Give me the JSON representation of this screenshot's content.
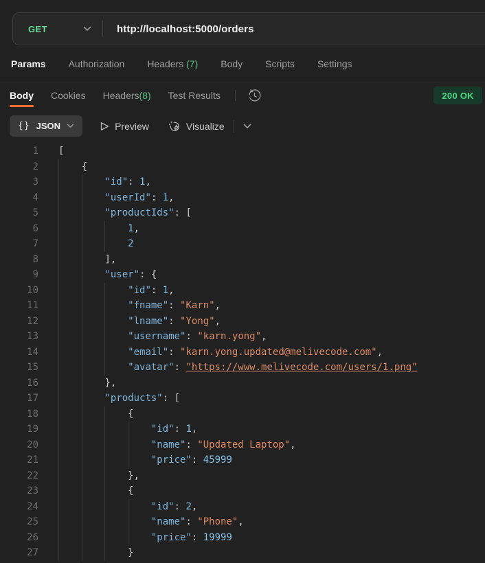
{
  "request": {
    "method": "GET",
    "url": "http://localhost:5000/orders",
    "tabs": [
      {
        "label": "Params",
        "count": "",
        "active": true
      },
      {
        "label": "Authorization",
        "count": "",
        "active": false
      },
      {
        "label": "Headers",
        "count": "(7)",
        "active": false
      },
      {
        "label": "Body",
        "count": "",
        "active": false
      },
      {
        "label": "Scripts",
        "count": "",
        "active": false
      },
      {
        "label": "Settings",
        "count": "",
        "active": false
      }
    ]
  },
  "response": {
    "tabs": [
      {
        "label": "Body",
        "count": "",
        "active": true
      },
      {
        "label": "Cookies",
        "count": "",
        "active": false
      },
      {
        "label": "Headers",
        "count": "(8)",
        "active": false
      },
      {
        "label": "Test Results",
        "count": "",
        "active": false
      }
    ],
    "status_badge": "200 OK",
    "toolbar": {
      "format_icon": "{}",
      "format_label": "JSON",
      "preview_label": "Preview",
      "visualize_label": "Visualize"
    }
  },
  "colors": {
    "accent_orange": "#ff6c37",
    "method_green": "#6bdd9a",
    "count_green": "#59c189",
    "status_text_green": "#4fd783",
    "status_bg_green": "#16392a",
    "key_blue": "#7db5dd",
    "number_blue": "#86c2e6",
    "string_orange": "#dd8a65"
  },
  "code": {
    "lines": [
      {
        "n": "1",
        "indent": 0,
        "tokens": [
          [
            "p",
            "["
          ]
        ]
      },
      {
        "n": "2",
        "indent": 4,
        "tokens": [
          [
            "p",
            "{"
          ]
        ]
      },
      {
        "n": "3",
        "indent": 8,
        "tokens": [
          [
            "k",
            "\"id\""
          ],
          [
            "p",
            ": "
          ],
          [
            "n",
            "1"
          ],
          [
            "p",
            ","
          ]
        ]
      },
      {
        "n": "4",
        "indent": 8,
        "tokens": [
          [
            "k",
            "\"userId\""
          ],
          [
            "p",
            ": "
          ],
          [
            "n",
            "1"
          ],
          [
            "p",
            ","
          ]
        ]
      },
      {
        "n": "5",
        "indent": 8,
        "tokens": [
          [
            "k",
            "\"productIds\""
          ],
          [
            "p",
            ": ["
          ]
        ]
      },
      {
        "n": "6",
        "indent": 12,
        "tokens": [
          [
            "n",
            "1"
          ],
          [
            "p",
            ","
          ]
        ]
      },
      {
        "n": "7",
        "indent": 12,
        "tokens": [
          [
            "n",
            "2"
          ]
        ]
      },
      {
        "n": "8",
        "indent": 8,
        "tokens": [
          [
            "p",
            "],"
          ]
        ]
      },
      {
        "n": "9",
        "indent": 8,
        "tokens": [
          [
            "k",
            "\"user\""
          ],
          [
            "p",
            ": {"
          ]
        ]
      },
      {
        "n": "10",
        "indent": 12,
        "tokens": [
          [
            "k",
            "\"id\""
          ],
          [
            "p",
            ": "
          ],
          [
            "n",
            "1"
          ],
          [
            "p",
            ","
          ]
        ]
      },
      {
        "n": "11",
        "indent": 12,
        "tokens": [
          [
            "k",
            "\"fname\""
          ],
          [
            "p",
            ": "
          ],
          [
            "s",
            "\"Karn\""
          ],
          [
            "p",
            ","
          ]
        ]
      },
      {
        "n": "12",
        "indent": 12,
        "tokens": [
          [
            "k",
            "\"lname\""
          ],
          [
            "p",
            ": "
          ],
          [
            "s",
            "\"Yong\""
          ],
          [
            "p",
            ","
          ]
        ]
      },
      {
        "n": "13",
        "indent": 12,
        "tokens": [
          [
            "k",
            "\"username\""
          ],
          [
            "p",
            ": "
          ],
          [
            "s",
            "\"karn.yong\""
          ],
          [
            "p",
            ","
          ]
        ]
      },
      {
        "n": "14",
        "indent": 12,
        "tokens": [
          [
            "k",
            "\"email\""
          ],
          [
            "p",
            ": "
          ],
          [
            "s",
            "\"karn.yong.updated@melivecode.com\""
          ],
          [
            "p",
            ","
          ]
        ]
      },
      {
        "n": "15",
        "indent": 12,
        "tokens": [
          [
            "k",
            "\"avatar\""
          ],
          [
            "p",
            ": "
          ],
          [
            "l",
            "\"https://www.melivecode.com/users/1.png\""
          ]
        ]
      },
      {
        "n": "16",
        "indent": 8,
        "tokens": [
          [
            "p",
            "},"
          ]
        ]
      },
      {
        "n": "17",
        "indent": 8,
        "tokens": [
          [
            "k",
            "\"products\""
          ],
          [
            "p",
            ": ["
          ]
        ]
      },
      {
        "n": "18",
        "indent": 12,
        "tokens": [
          [
            "p",
            "{"
          ]
        ]
      },
      {
        "n": "19",
        "indent": 16,
        "tokens": [
          [
            "k",
            "\"id\""
          ],
          [
            "p",
            ": "
          ],
          [
            "n",
            "1"
          ],
          [
            "p",
            ","
          ]
        ]
      },
      {
        "n": "20",
        "indent": 16,
        "tokens": [
          [
            "k",
            "\"name\""
          ],
          [
            "p",
            ": "
          ],
          [
            "s",
            "\"Updated Laptop\""
          ],
          [
            "p",
            ","
          ]
        ]
      },
      {
        "n": "21",
        "indent": 16,
        "tokens": [
          [
            "k",
            "\"price\""
          ],
          [
            "p",
            ": "
          ],
          [
            "n",
            "45999"
          ]
        ]
      },
      {
        "n": "22",
        "indent": 12,
        "tokens": [
          [
            "p",
            "},"
          ]
        ]
      },
      {
        "n": "23",
        "indent": 12,
        "tokens": [
          [
            "p",
            "{"
          ]
        ]
      },
      {
        "n": "24",
        "indent": 16,
        "tokens": [
          [
            "k",
            "\"id\""
          ],
          [
            "p",
            ": "
          ],
          [
            "n",
            "2"
          ],
          [
            "p",
            ","
          ]
        ]
      },
      {
        "n": "25",
        "indent": 16,
        "tokens": [
          [
            "k",
            "\"name\""
          ],
          [
            "p",
            ": "
          ],
          [
            "s",
            "\"Phone\""
          ],
          [
            "p",
            ","
          ]
        ]
      },
      {
        "n": "26",
        "indent": 16,
        "tokens": [
          [
            "k",
            "\"price\""
          ],
          [
            "p",
            ": "
          ],
          [
            "n",
            "19999"
          ]
        ]
      },
      {
        "n": "27",
        "indent": 12,
        "tokens": [
          [
            "p",
            "}"
          ]
        ]
      }
    ]
  }
}
